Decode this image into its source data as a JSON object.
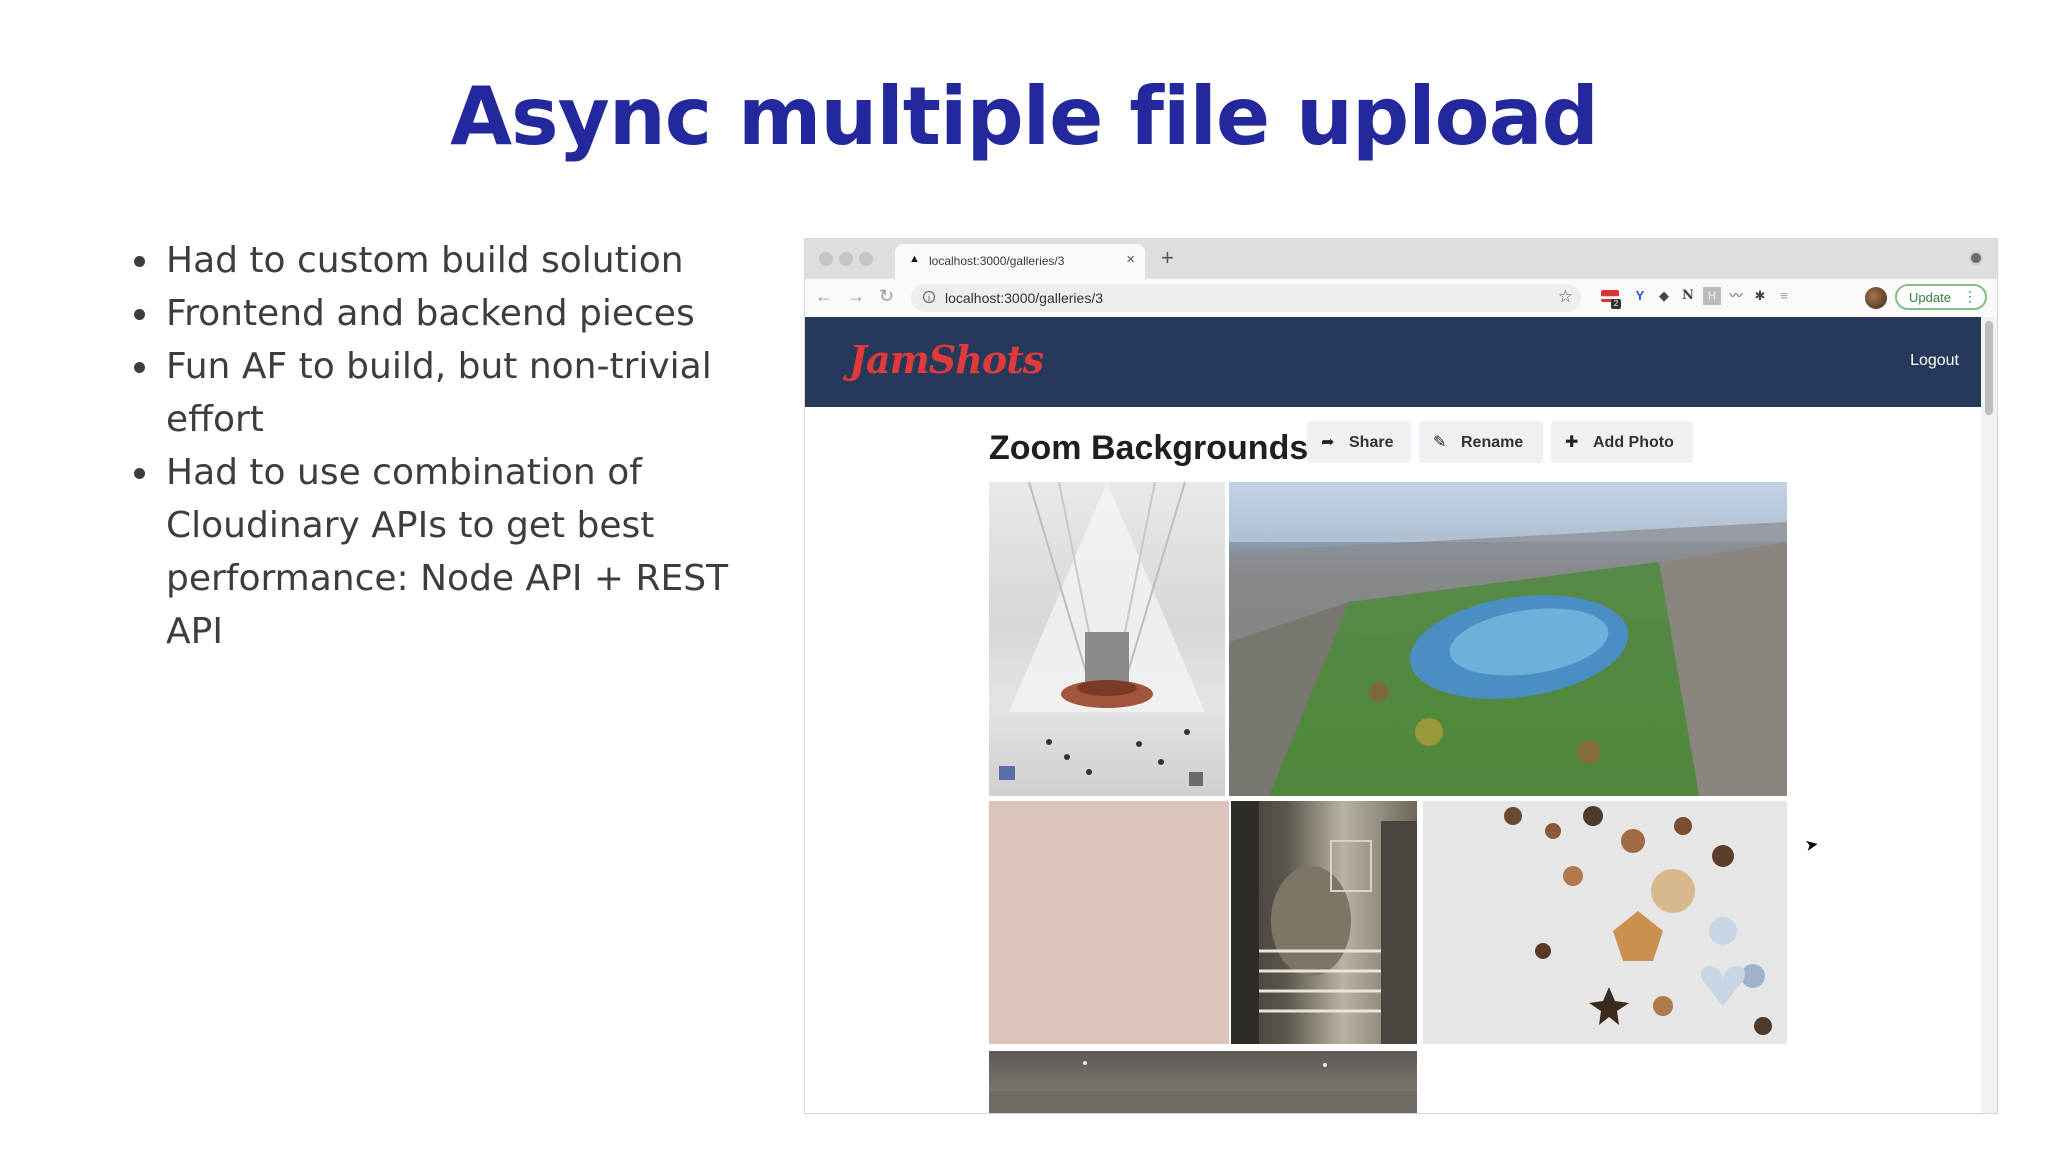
{
  "slide": {
    "title": "Async multiple file upload",
    "bullets": [
      "Had to custom build solution",
      "Frontend and backend pieces",
      "Fun AF to build, but non-trivial effort",
      "Had to use combination of Cloudinary APIs to get best performance: Node API + REST API"
    ]
  },
  "browser": {
    "tab_title": "localhost:3000/galleries/3",
    "address": "localhost:3000/galleries/3",
    "new_tab_symbol": "+",
    "update_label": "Update",
    "extension_badge": "2"
  },
  "app": {
    "logo_text": "JamShots",
    "logout_label": "Logout",
    "brand_color": "#26395a",
    "logo_color": "#e23a3a"
  },
  "gallery": {
    "title": "Zoom Backgrounds",
    "buttons": [
      {
        "icon": "share-icon",
        "label": "Share"
      },
      {
        "icon": "edit-icon",
        "label": "Rename"
      },
      {
        "icon": "plus-icon",
        "label": "Add Photo"
      }
    ],
    "photos": [
      {
        "name": "photo-oculus-hall"
      },
      {
        "name": "photo-central-park-aerial"
      },
      {
        "name": "photo-pink-wall"
      },
      {
        "name": "photo-office-window"
      },
      {
        "name": "photo-holiday-cookies"
      },
      {
        "name": "photo-interior-partial"
      }
    ]
  }
}
